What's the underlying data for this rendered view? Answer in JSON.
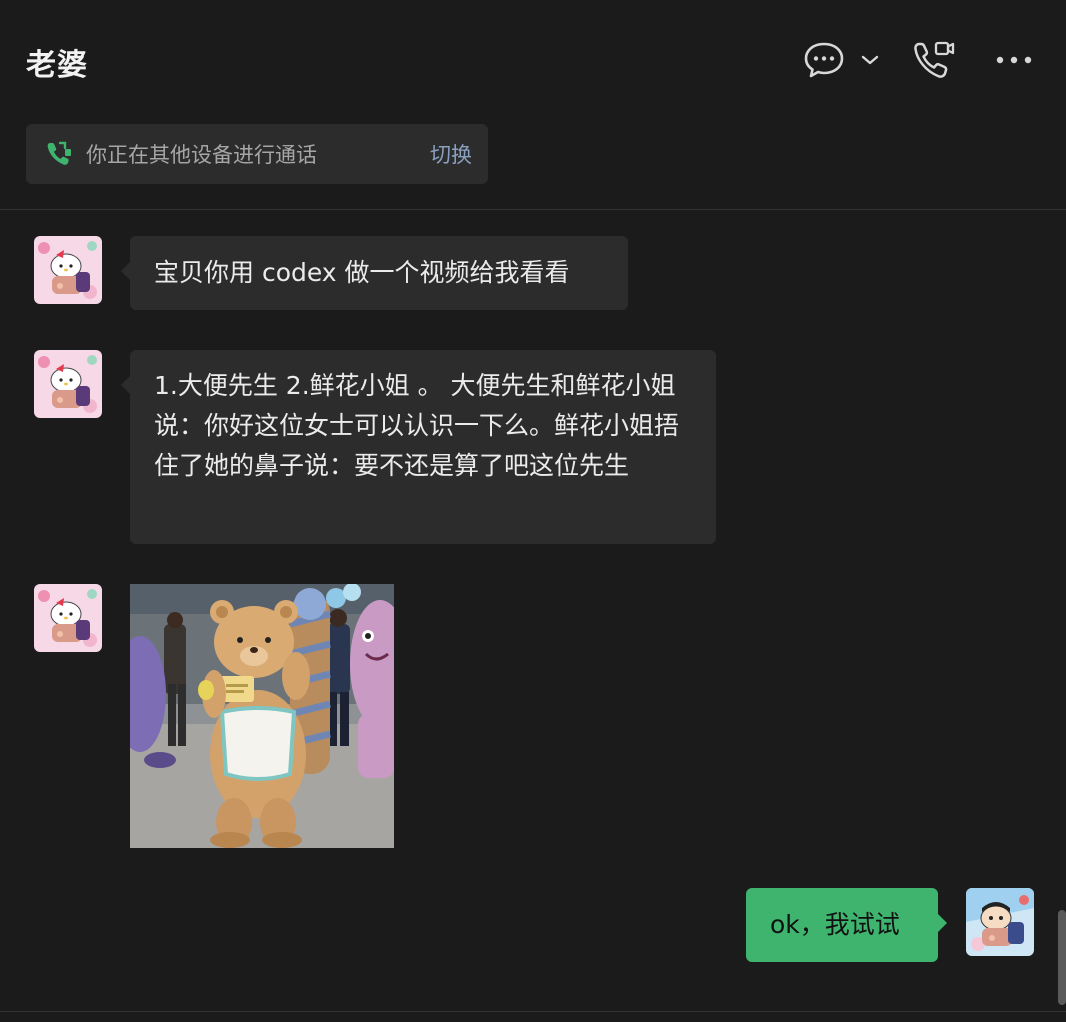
{
  "chat": {
    "title": "老婆"
  },
  "call_banner": {
    "text": "你正在其他设备进行通话",
    "switch_label": "切换"
  },
  "messages": [
    {
      "sender": "contact",
      "type": "text",
      "text": "宝贝你用 codex 做一个视频给我看看"
    },
    {
      "sender": "contact",
      "type": "text",
      "text": "1.大便先生 2.鲜花小姐 。 大便先生和鲜花小姐说：你好这位女士可以认识一下么。鲜花小姐捂住了她的鼻子说：要不还是算了吧这位先生"
    },
    {
      "sender": "contact",
      "type": "image"
    },
    {
      "sender": "me",
      "type": "text",
      "text": "ok，我试试"
    }
  ],
  "icons": {
    "chat": "speech-bubble-icon",
    "dropdown": "chevron-down-icon",
    "call": "phone-video-icon",
    "more": "more-dots-icon",
    "banner": "phone-green-icon"
  },
  "colors": {
    "background": "#1b1b1b",
    "bubble_other": "#2c2c2c",
    "bubble_me": "#3eb46f",
    "accent_green": "#3eb46f",
    "link": "#8aa0bf"
  }
}
